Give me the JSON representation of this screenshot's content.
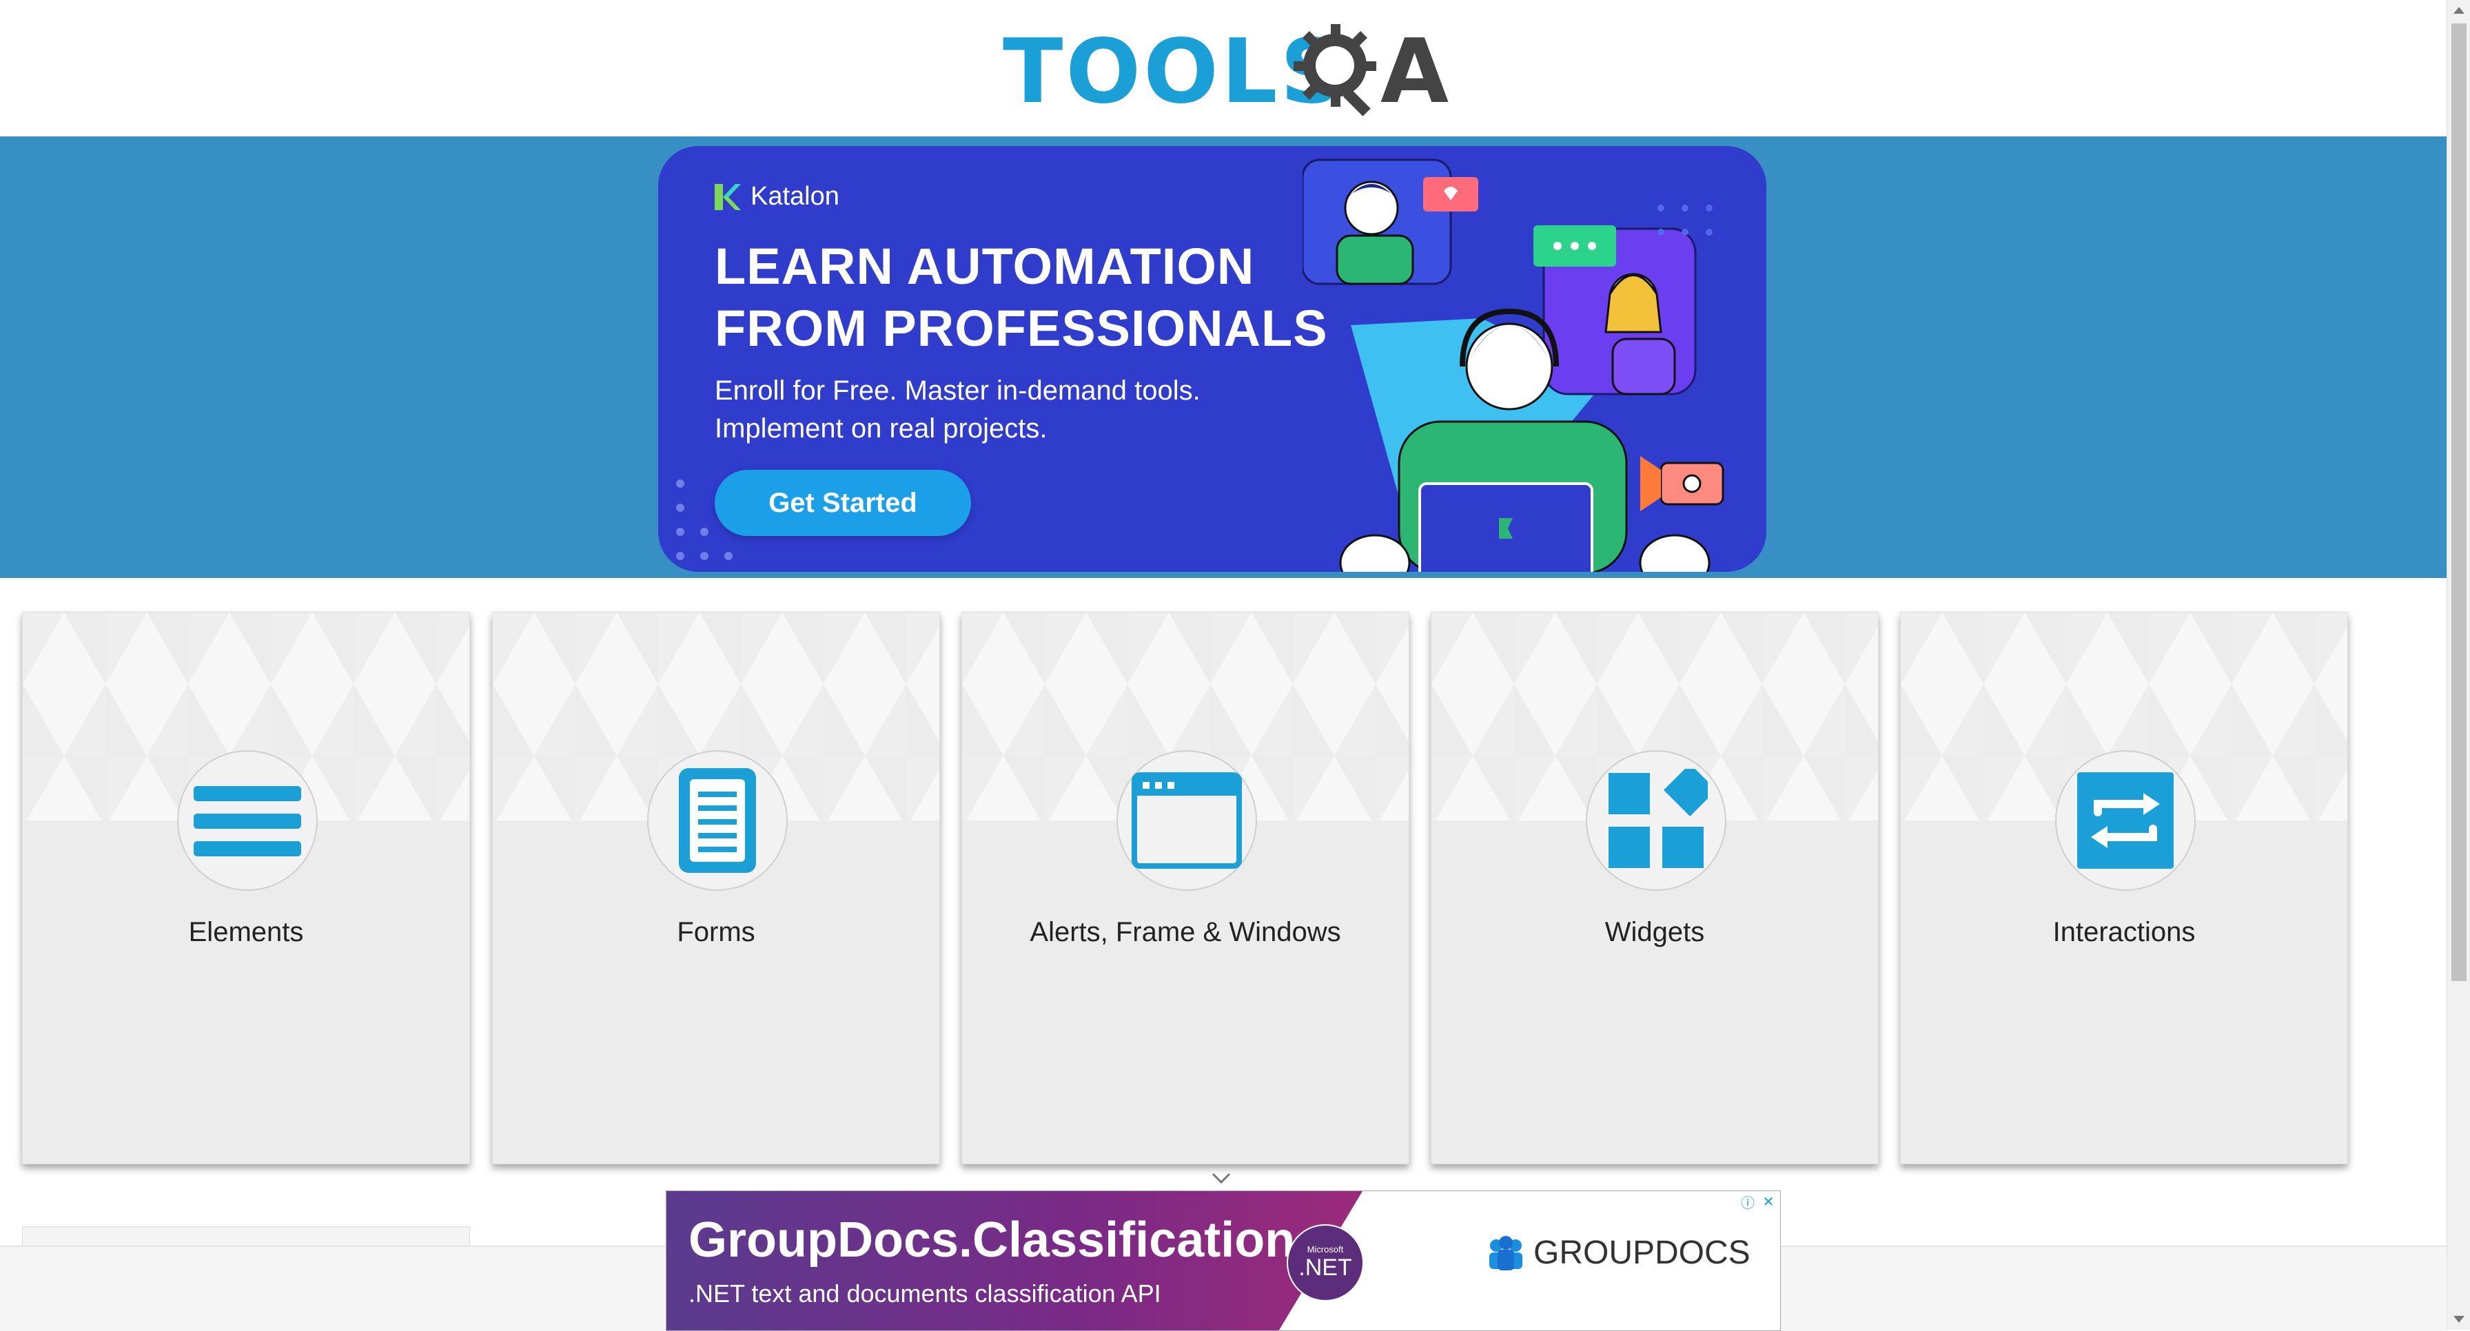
{
  "header": {
    "logo_text": "TOOLS",
    "logo_suffix": "A"
  },
  "banner": {
    "brand": "Katalon",
    "headline_line1": "LEARN AUTOMATION",
    "headline_line2": "FROM PROFESSIONALS",
    "sub_line1": "Enroll for Free. Master in-demand tools.",
    "sub_line2": "Implement on real projects.",
    "cta": "Get Started",
    "colors": {
      "bg": "#378fc3",
      "card": "#2f3ccc",
      "cta": "#1a9fe8"
    }
  },
  "cards": [
    {
      "title": "Elements",
      "icon": "hamburger-icon"
    },
    {
      "title": "Forms",
      "icon": "document-icon"
    },
    {
      "title": "Alerts, Frame & Windows",
      "icon": "browser-window-icon"
    },
    {
      "title": "Widgets",
      "icon": "widgets-icon"
    },
    {
      "title": "Interactions",
      "icon": "swap-arrows-icon"
    }
  ],
  "bottom_ad": {
    "title": "GroupDocs.Classification",
    "subtitle": ".NET text and documents classification API",
    "badge_small": "Microsoft",
    "badge": ".NET",
    "brand": "GROUPDOCS"
  },
  "accent": "#1a9fd6"
}
